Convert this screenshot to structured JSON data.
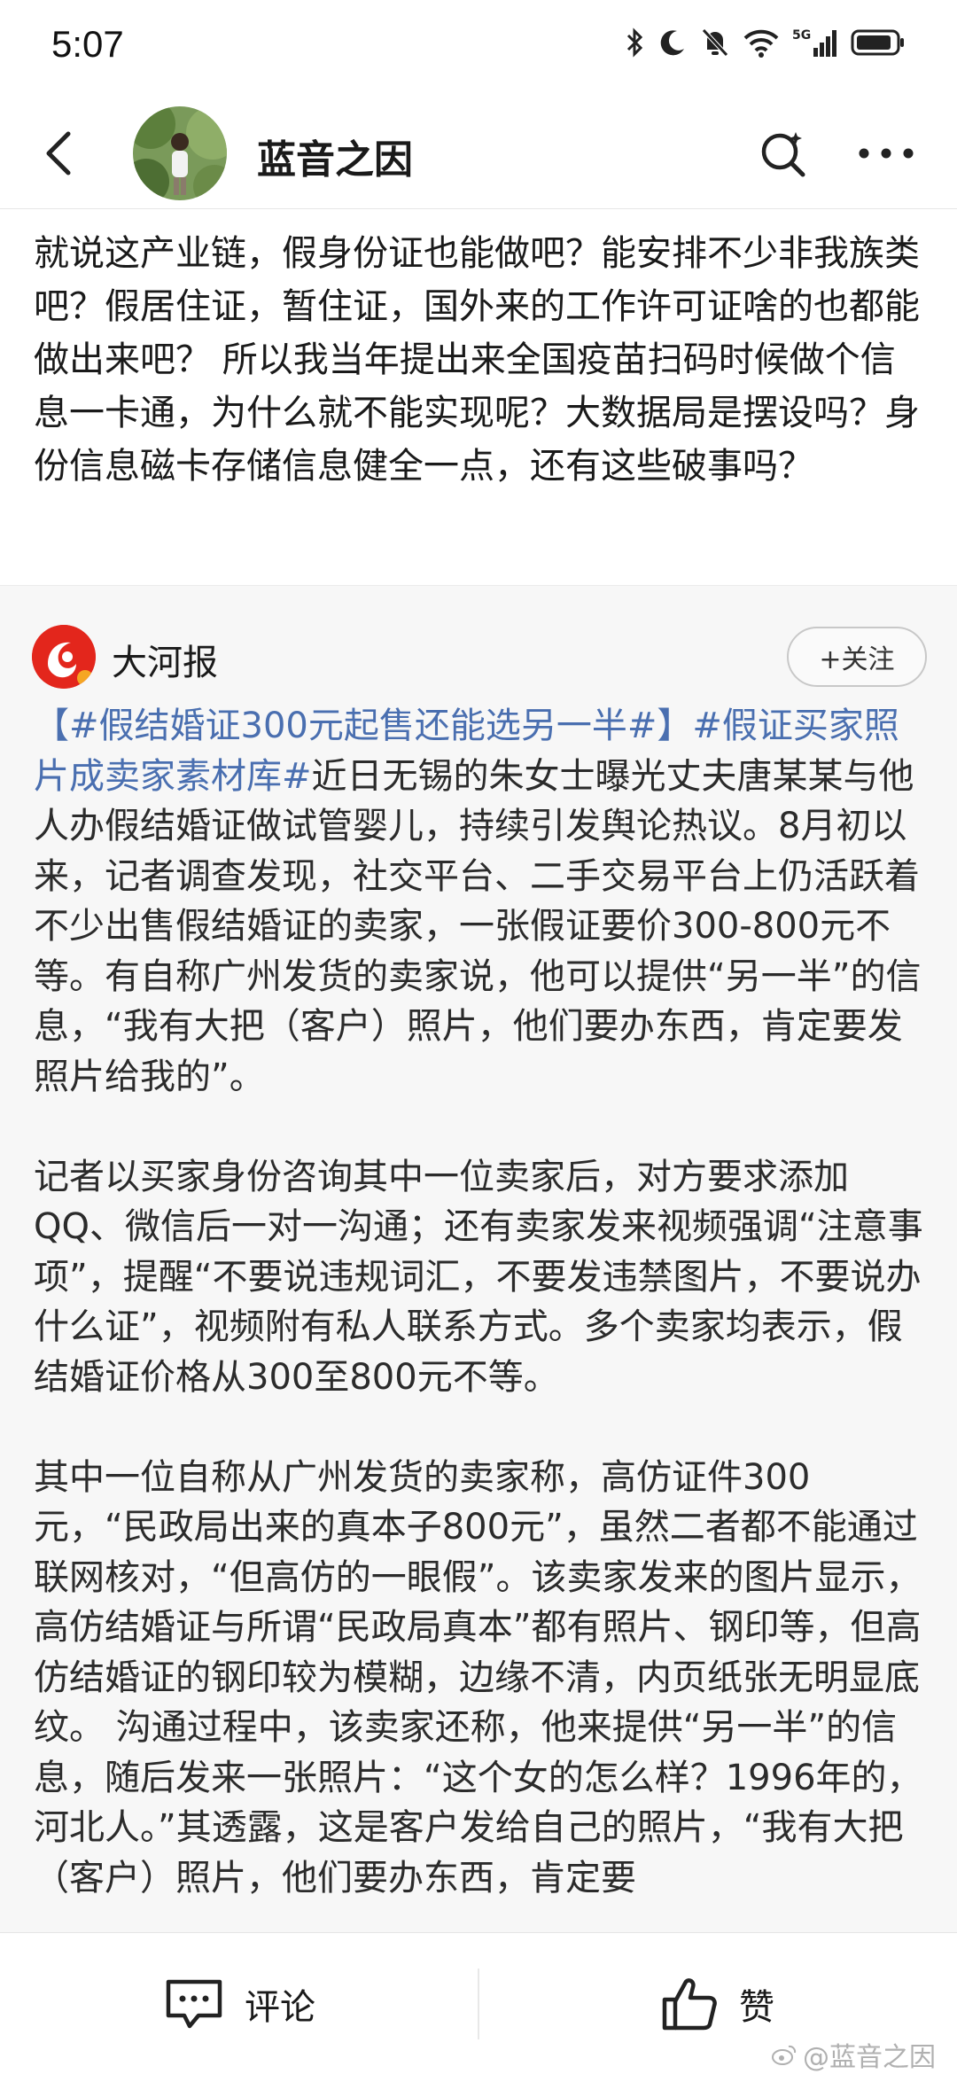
{
  "status_bar": {
    "time": "5:07",
    "icons": [
      "bluetooth-icon",
      "moon-icon",
      "mute-bell-icon",
      "wifi-icon",
      "5g-signal-icon",
      "battery-icon"
    ]
  },
  "header": {
    "title": "蓝音之因",
    "icons": [
      "back-arrow-icon",
      "search-icon",
      "more-icon"
    ]
  },
  "post": {
    "text": "就说这产业链，假身份证也能做吧？能安排不少非我族类吧？假居住证，暂住证，国外来的工作许可证啥的也都能做出来吧？ 所以我当年提出来全国疫苗扫码时候做个信息一卡通，为什么就不能实现呢？大数据局是摆设吗？身份信息磁卡存储信息健全一点，还有这些破事吗？"
  },
  "repost": {
    "author": "大河报",
    "follow_label": "+关注",
    "hashtag1": "【#假结婚证300元起售还能选另一半#】",
    "hashtag2": "#假证买家照片成卖家素材库#",
    "p1_rest": "近日无锡的朱女士曝光丈夫唐某某与他人办假结婚证做试管婴儿，持续引发舆论热议。8月初以来，记者调查发现，社交平台、二手交易平台上仍活跃着不少出售假结婚证的卖家，一张假证要价300-800元不等。有自称广州发货的卖家说，他可以提供“另一半”的信息，“我有大把（客户）照片，他们要办东西，肯定要发照片给我的”。",
    "p2": "记者以买家身份咨询其中一位卖家后，对方要求添加QQ、微信后一对一沟通；还有卖家发来视频强调“注意事项”，提醒“不要说违规词汇，不要发违禁图片，不要说办什么证”，视频附有私人联系方式。多个卖家均表示，假结婚证价格从300至800元不等。",
    "p3": "其中一位自称从广州发货的卖家称，高仿证件300元，“民政局出来的真本子800元”，虽然二者都不能通过联网核对，“但高仿的一眼假”。该卖家发来的图片显示，高仿结婚证与所谓“民政局真本”都有照片、钢印等，但高仿结婚证的钢印较为模糊，边缘不清，内页纸张无明显底纹。 沟通过程中，该卖家还称，他来提供“另一半”的信息，随后发来一张照片：“这个女的怎么样？1996年的，河北人。”其透露，这是客户发给自己的照片，“我有大把（客户）照片，他们要办东西，肯定要"
  },
  "bottom_bar": {
    "comment_label": "评论",
    "like_label": "赞",
    "watermark": "@蓝音之因"
  }
}
